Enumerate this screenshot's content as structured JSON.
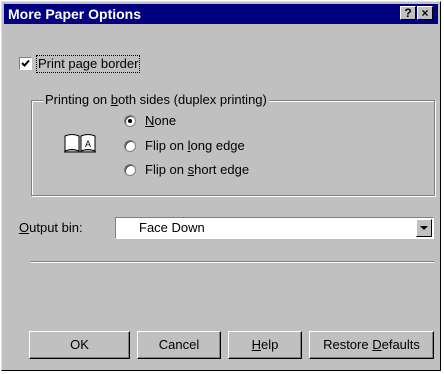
{
  "window": {
    "title": "More Paper Options",
    "help_glyph": "?",
    "close_glyph": "×"
  },
  "print_border": {
    "checked": true,
    "label": "Print page border"
  },
  "duplex": {
    "group_title_pre": "Printing on ",
    "group_title_u": "b",
    "group_title_post": "oth sides (duplex printing)",
    "icon": "book-icon",
    "options": [
      {
        "pre": "",
        "u": "N",
        "post": "one",
        "selected": true
      },
      {
        "pre": "Flip on ",
        "u": "l",
        "post": "ong edge",
        "selected": false
      },
      {
        "pre": "Flip on ",
        "u": "s",
        "post": "hort edge",
        "selected": false
      }
    ]
  },
  "output_bin": {
    "label_u": "O",
    "label_rest": "utput bin:",
    "value": "Face Down",
    "arrow_icon": "chevron-down-icon"
  },
  "buttons": {
    "ok": "OK",
    "cancel": "Cancel",
    "help_u": "H",
    "help_rest": "elp",
    "restore_pre": "Restore ",
    "restore_u": "D",
    "restore_post": "efaults"
  },
  "colors": {
    "title_bar": "#000080",
    "face": "#c0c0c0"
  }
}
